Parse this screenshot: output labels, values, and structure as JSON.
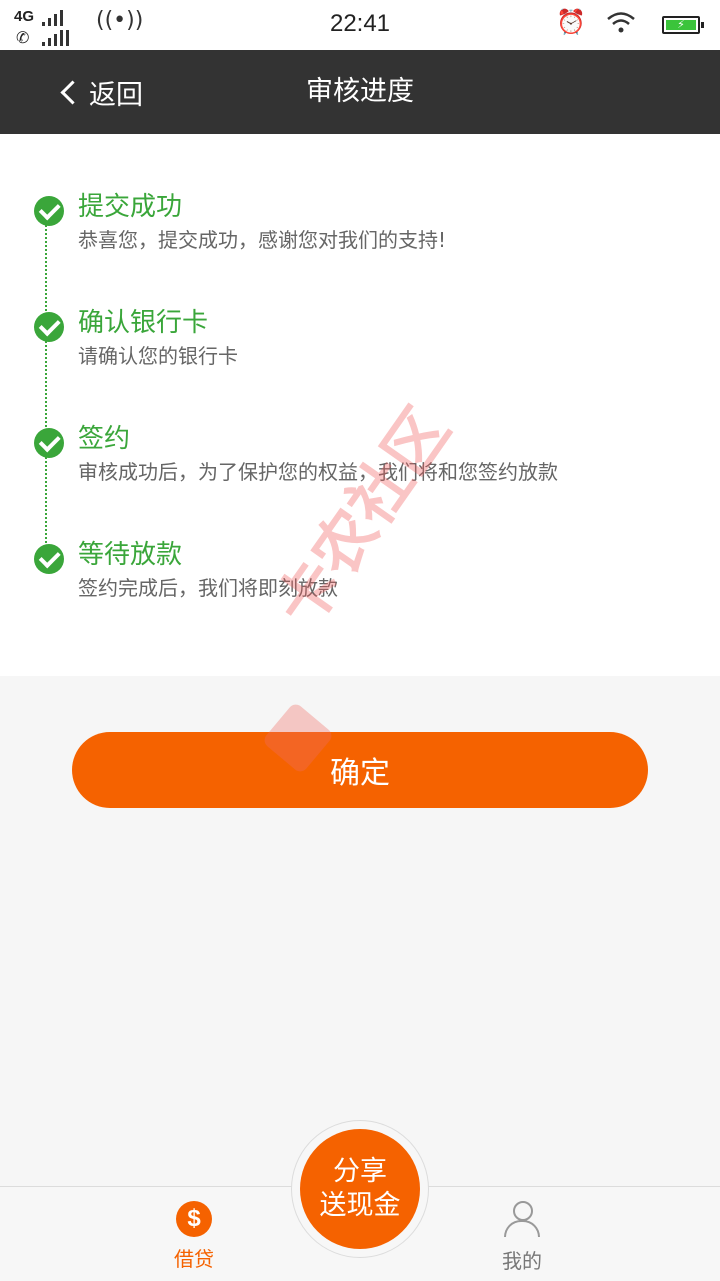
{
  "status_bar": {
    "network": "4G",
    "time": "22:41"
  },
  "header": {
    "back_label": "返回",
    "title": "审核进度"
  },
  "steps": [
    {
      "title": "提交成功",
      "desc": "恭喜您，提交成功，感谢您对我们的支持!"
    },
    {
      "title": "确认银行卡",
      "desc": "请确认您的银行卡"
    },
    {
      "title": "签约",
      "desc": "审核成功后，为了保护您的权益，我们将和您签约放款"
    },
    {
      "title": "等待放款",
      "desc": "签约完成后，我们将即刻放款"
    }
  ],
  "watermark": "卡农社区",
  "confirm_label": "确定",
  "share": {
    "line1": "分享",
    "line2": "送现金"
  },
  "bottom_nav": {
    "loan_label": "借贷",
    "loan_icon_glyph": "$",
    "mine_label": "我的"
  },
  "colors": {
    "accent": "#f56200",
    "success": "#3aa63a",
    "header_bg": "#333333"
  }
}
